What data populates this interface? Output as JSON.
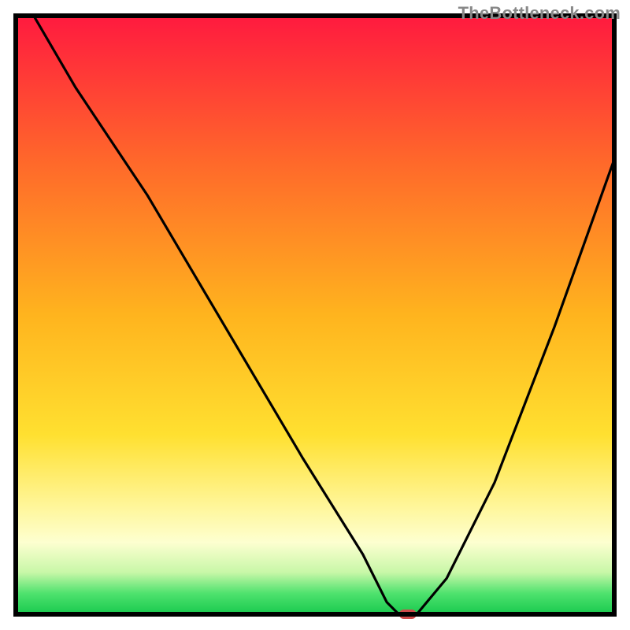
{
  "watermark": "TheBottleneck.com",
  "chart_data": {
    "type": "line",
    "title": "",
    "xlabel": "",
    "ylabel": "",
    "xlim": [
      0,
      100
    ],
    "ylim": [
      0,
      100
    ],
    "grid": false,
    "legend": false,
    "background": {
      "description": "vertical gradient from red (top) through orange/yellow to light-yellow band then green at the very bottom, bounded by a thick black frame",
      "stops": [
        {
          "pos": 0.0,
          "color": "#ff1a3f"
        },
        {
          "pos": 0.25,
          "color": "#ff6a2a"
        },
        {
          "pos": 0.5,
          "color": "#ffb41e"
        },
        {
          "pos": 0.7,
          "color": "#ffe030"
        },
        {
          "pos": 0.82,
          "color": "#fff69a"
        },
        {
          "pos": 0.88,
          "color": "#fdffd0"
        },
        {
          "pos": 0.93,
          "color": "#c8f7a8"
        },
        {
          "pos": 0.965,
          "color": "#4fe26e"
        },
        {
          "pos": 1.0,
          "color": "#18c94e"
        }
      ]
    },
    "series": [
      {
        "name": "bottleneck-curve",
        "stroke": "#000000",
        "x": [
          3,
          10,
          22,
          35,
          48,
          58,
          62,
          64,
          67,
          72,
          80,
          90,
          100
        ],
        "y": [
          100,
          88,
          70,
          48,
          26,
          10,
          2,
          0,
          0,
          6,
          22,
          48,
          76
        ]
      }
    ],
    "marker": {
      "name": "optimal-point",
      "x": 65.5,
      "y": 0,
      "color": "#cf4a4a",
      "shape": "rounded-rect"
    },
    "frame": {
      "inset": 20,
      "stroke": "#000000",
      "stroke_width": 6
    }
  }
}
